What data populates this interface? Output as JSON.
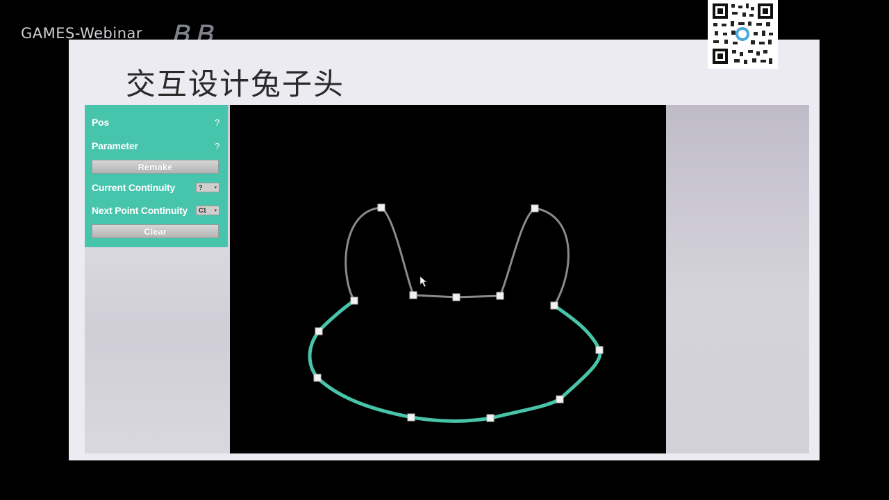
{
  "watermark": {
    "text": "GAMES-Webinar",
    "logo_text": "bilibili"
  },
  "slide": {
    "title": "交互设计兔子头"
  },
  "panel": {
    "pos_label": "Pos",
    "pos_help": "?",
    "parameter_label": "Parameter",
    "parameter_help": "?",
    "remake_button": "Remake",
    "current_continuity_label": "Current Continuity",
    "current_continuity_value": "?",
    "next_point_continuity_label": "Next Point Continuity",
    "next_point_continuity_value": "C1",
    "clear_button": "Clear"
  },
  "colors": {
    "panel": "#47c4ac",
    "curve_active": "#48c4a8",
    "curve_inactive": "#8a8a8a",
    "control_point": "#f2f2f2",
    "canvas": "#000000"
  },
  "icons": {
    "qr": "qr-code-icon",
    "cursor": "mouse-cursor-icon",
    "dropdown": "chevron-down-icon"
  }
}
